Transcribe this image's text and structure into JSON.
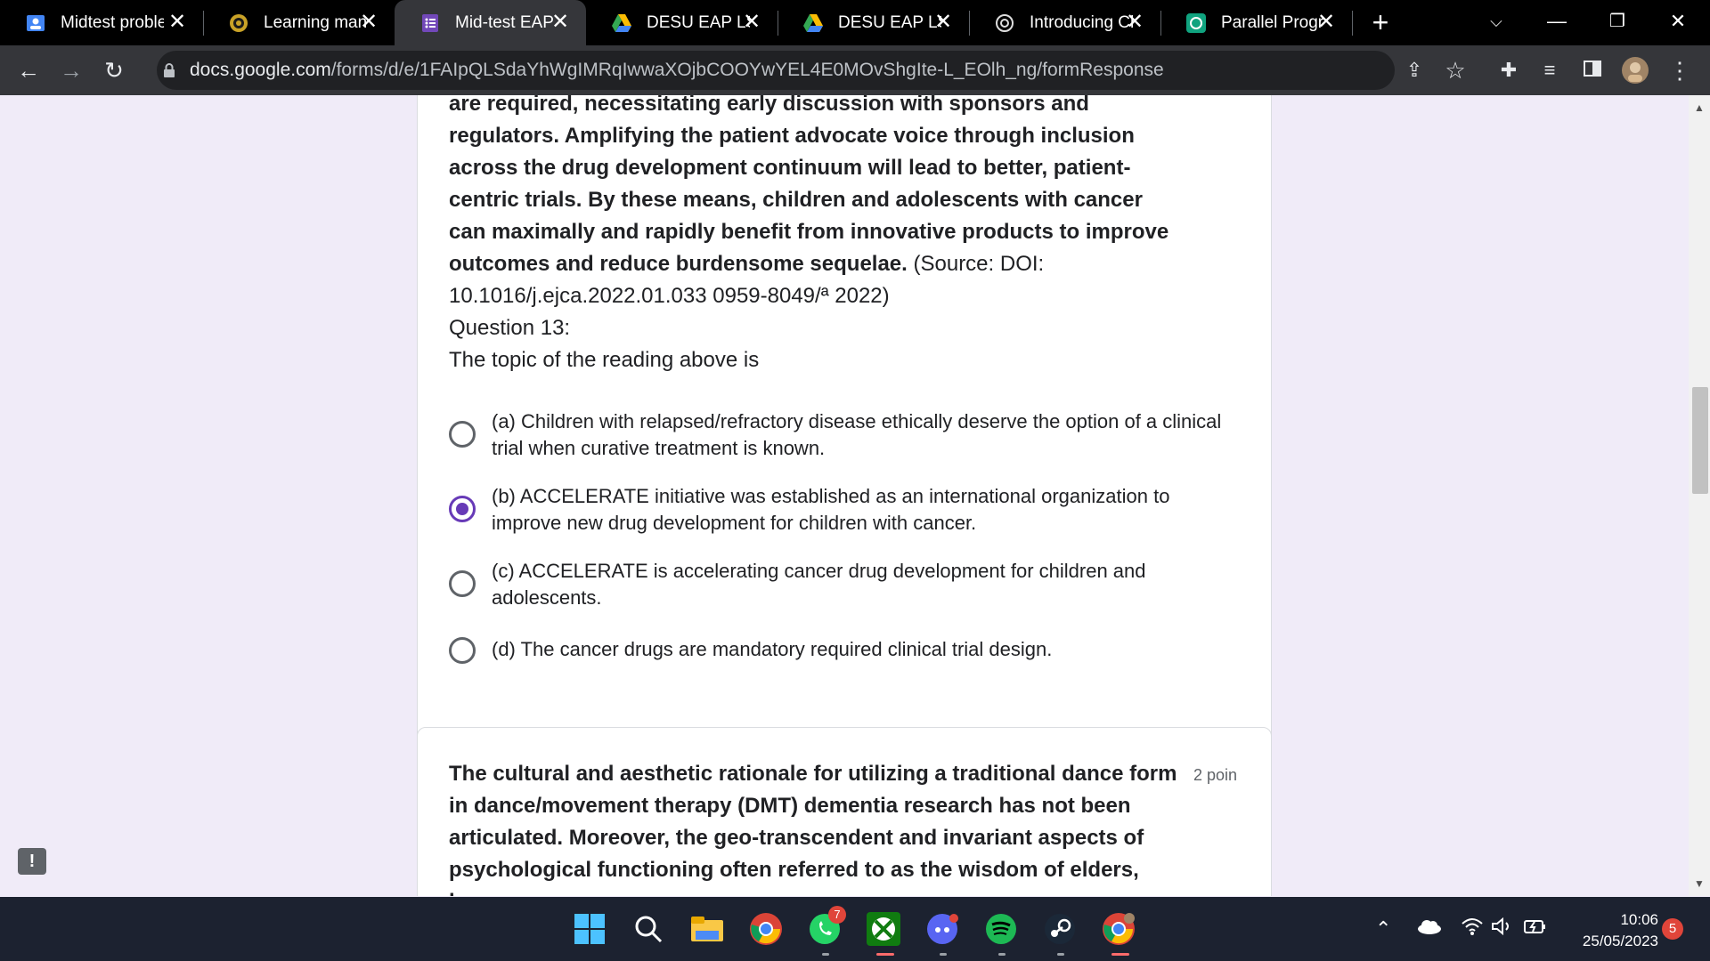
{
  "browser": {
    "tabs": [
      {
        "title": "Midtest proble",
        "icon": "classroom-icon",
        "active": false
      },
      {
        "title": "Learning mana",
        "icon": "university-seal-icon",
        "active": false
      },
      {
        "title": "Mid-test EAP",
        "icon": "google-forms-icon",
        "active": true
      },
      {
        "title": "DESU EAP LS M",
        "icon": "google-drive-icon",
        "active": false
      },
      {
        "title": "DESU EAP LS M",
        "icon": "google-drive-icon",
        "active": false
      },
      {
        "title": "Introducing Ch",
        "icon": "openai-icon",
        "active": false
      },
      {
        "title": "Parallel Progra",
        "icon": "openai-icon",
        "active": false
      }
    ],
    "url_host": "docs.google.com",
    "url_path": "/forms/d/e/1FAIpQLSdaYhWgIMRqIwwaXOjbCOOYwYEL4E0MOvShgIte-L_EOlh_ng/formResponse"
  },
  "passage": {
    "bold_text": "are required, necessitating early discussion with sponsors and regulators. Amplifying the patient advocate voice through inclusion across the drug development continuum will lead to better, patient-centric trials. By these means, children and adolescents with cancer can maximally and rapidly benefit from innovative products to improve outcomes and reduce burdensome sequelae.",
    "source": " (Source: DOI: 10.1016/j.ejca.2022.01.033 0959-8049/ª 2022)"
  },
  "question": {
    "number": "Question 13:",
    "prompt": "The topic of the reading above is",
    "options": [
      {
        "label": "(a) Children with relapsed/refractory disease ethically deserve the option of a clinical trial when curative treatment is known.",
        "selected": false
      },
      {
        "label": "(b) ACCELERATE initiative was established as an international organization to improve new drug development for children with cancer.",
        "selected": true
      },
      {
        "label": "(c) ACCELERATE is accelerating cancer drug development for children and adolescents.",
        "selected": false
      },
      {
        "label": "(d) The cancer drugs are mandatory required clinical trial design.",
        "selected": false
      }
    ]
  },
  "next_question": {
    "text": "The cultural and aesthetic rationale for utilizing a traditional dance form in dance/movement therapy (DMT) dementia research has not been articulated. Moreover, the geo-transcendent and invariant aspects of psychological functioning often referred to as the wisdom of elders, have",
    "points": "2 poin"
  },
  "taskbar": {
    "apps": [
      "windows-start-icon",
      "search-icon",
      "file-explorer-icon",
      "chrome-icon",
      "whatsapp-icon",
      "xbox-icon",
      "discord-icon",
      "spotify-icon",
      "steam-icon",
      "chrome-profile-icon"
    ],
    "whatsapp_badge": "7",
    "time": "10:06",
    "date": "25/05/2023",
    "notification_count": "5"
  },
  "colors": {
    "accent": "#673ab7",
    "page_bg": "#f0ebf8"
  }
}
